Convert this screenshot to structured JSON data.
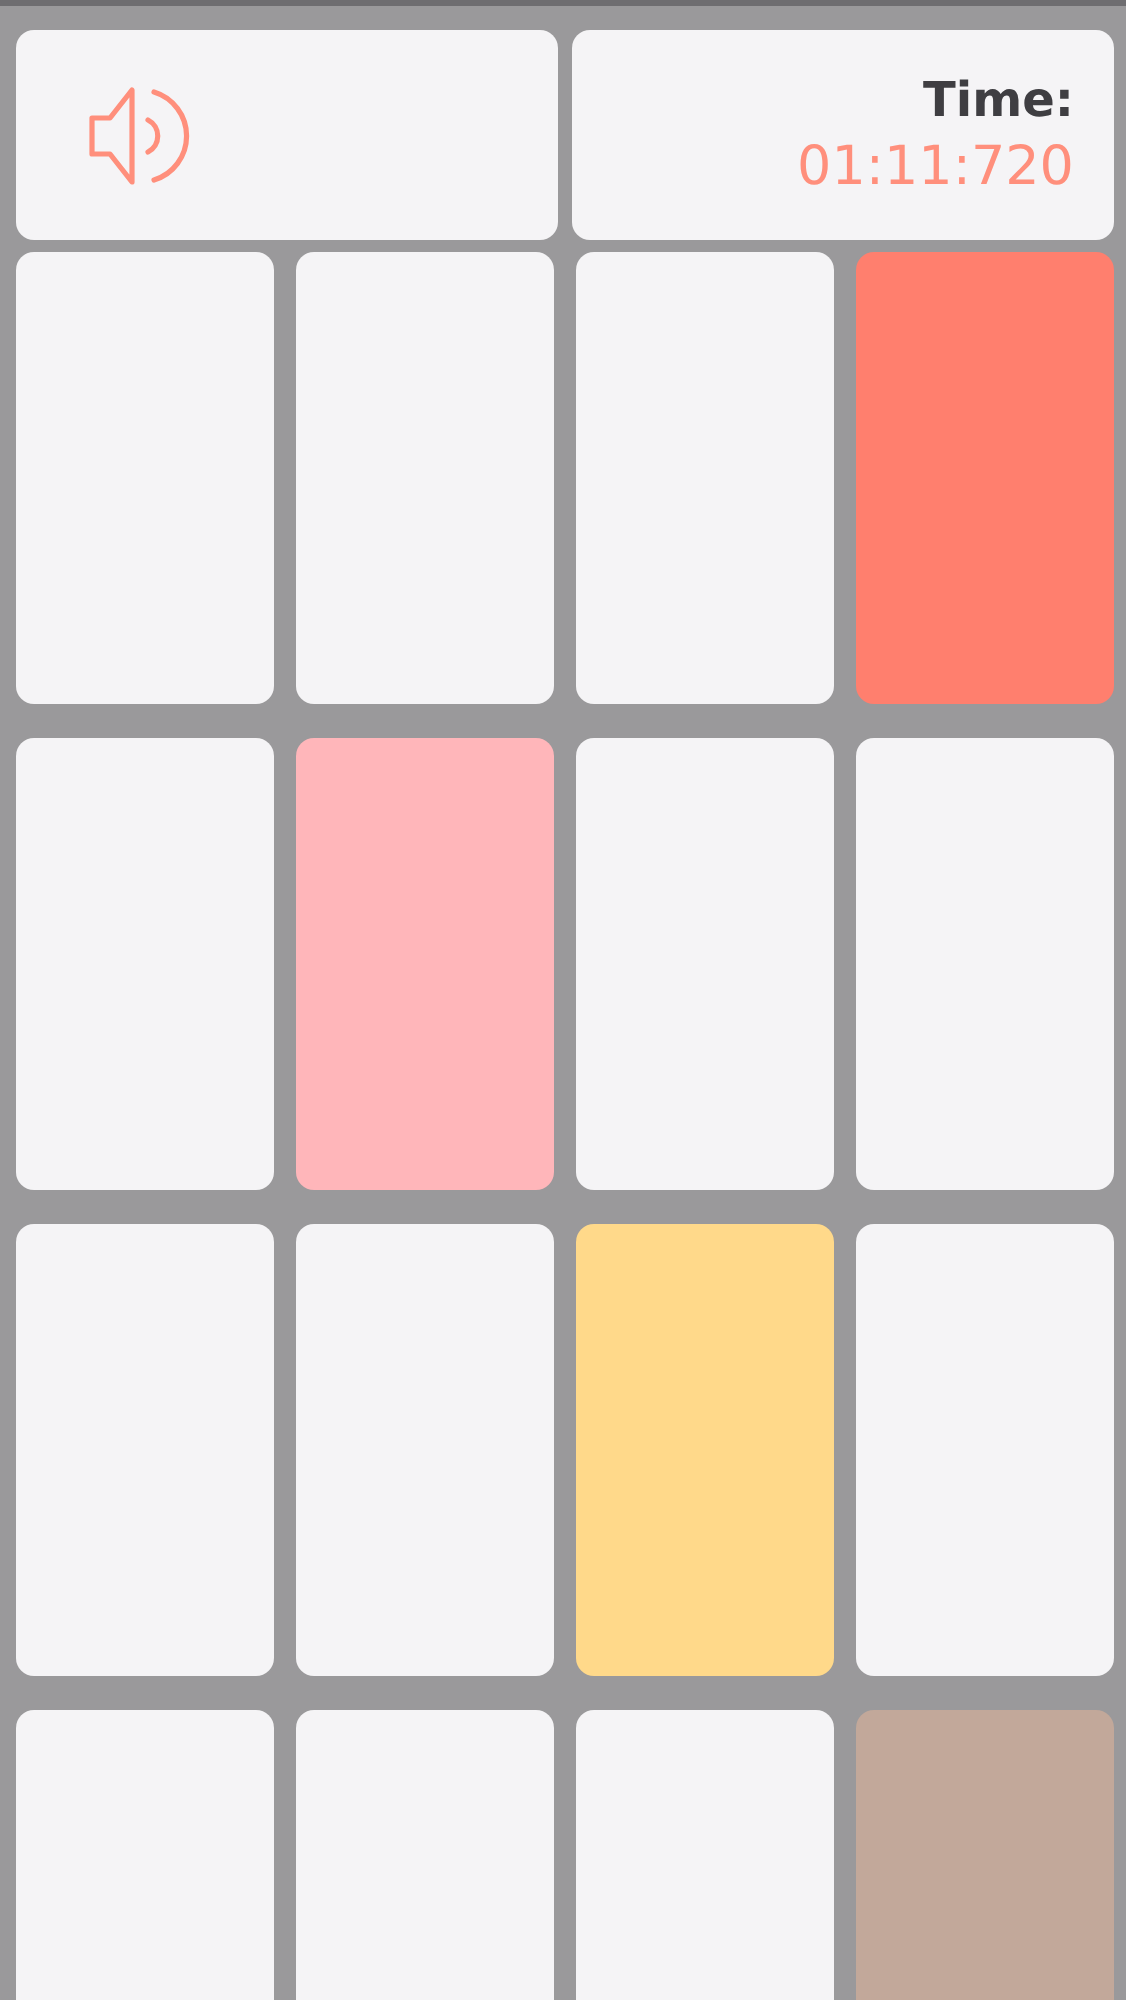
{
  "header": {
    "sound": {
      "on": true
    },
    "timer": {
      "label": "Time:",
      "value": "01:11:720"
    }
  },
  "board": {
    "rows": [
      {
        "tiles": [
          {
            "color": "#f5f4f6"
          },
          {
            "color": "#f5f4f6"
          },
          {
            "color": "#f5f4f6"
          },
          {
            "color": "#ff7f6e"
          }
        ]
      },
      {
        "tiles": [
          {
            "color": "#f5f4f6"
          },
          {
            "color": "#ffb6ba"
          },
          {
            "color": "#f5f4f6"
          },
          {
            "color": "#f5f4f6"
          }
        ]
      },
      {
        "tiles": [
          {
            "color": "#f5f4f6"
          },
          {
            "color": "#f5f4f6"
          },
          {
            "color": "#ffd98a"
          },
          {
            "color": "#f5f4f6"
          }
        ]
      },
      {
        "tiles": [
          {
            "color": "#f5f4f6"
          },
          {
            "color": "#f5f4f6"
          },
          {
            "color": "#f5f4f6"
          },
          {
            "color": "#c2a89a"
          }
        ]
      }
    ]
  }
}
